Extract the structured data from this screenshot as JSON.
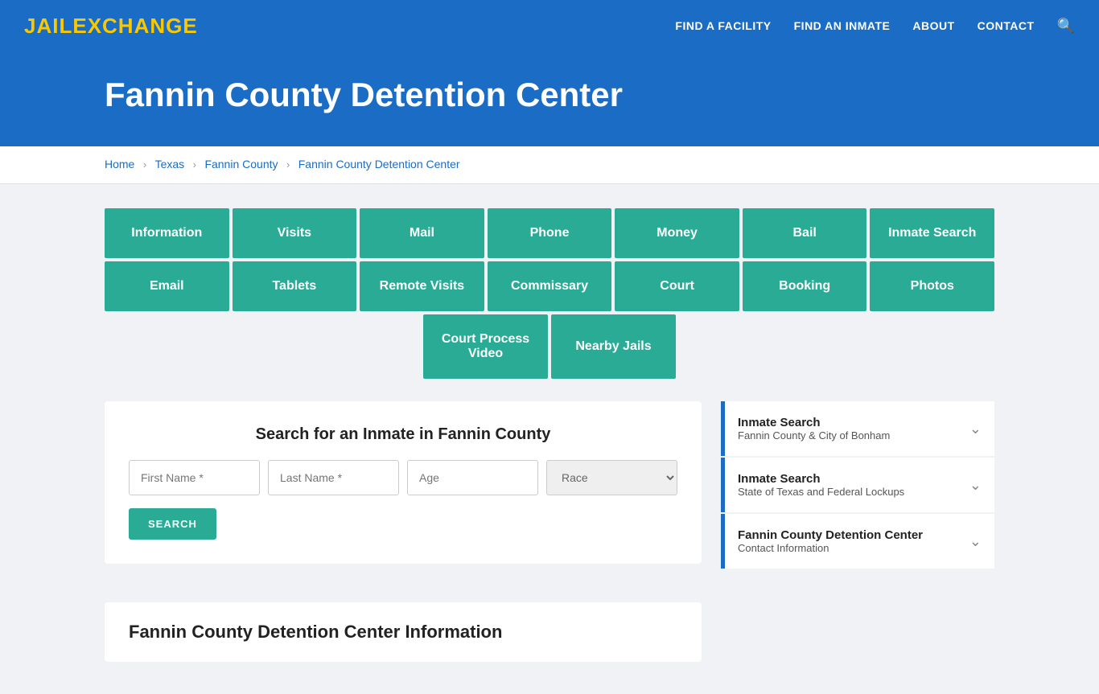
{
  "nav": {
    "logo_jail": "JAIL",
    "logo_exchange": "EXCHANGE",
    "links": [
      {
        "label": "FIND A FACILITY",
        "name": "find-facility"
      },
      {
        "label": "FIND AN INMATE",
        "name": "find-inmate"
      },
      {
        "label": "ABOUT",
        "name": "about"
      },
      {
        "label": "CONTACT",
        "name": "contact"
      }
    ]
  },
  "hero": {
    "title": "Fannin County Detention Center"
  },
  "breadcrumb": {
    "items": [
      {
        "label": "Home",
        "name": "breadcrumb-home"
      },
      {
        "label": "Texas",
        "name": "breadcrumb-texas"
      },
      {
        "label": "Fannin County",
        "name": "breadcrumb-county"
      },
      {
        "label": "Fannin County Detention Center",
        "name": "breadcrumb-facility"
      }
    ]
  },
  "grid_buttons": {
    "row1": [
      {
        "label": "Information",
        "name": "btn-information"
      },
      {
        "label": "Visits",
        "name": "btn-visits"
      },
      {
        "label": "Mail",
        "name": "btn-mail"
      },
      {
        "label": "Phone",
        "name": "btn-phone"
      },
      {
        "label": "Money",
        "name": "btn-money"
      },
      {
        "label": "Bail",
        "name": "btn-bail"
      },
      {
        "label": "Inmate Search",
        "name": "btn-inmate-search"
      }
    ],
    "row2": [
      {
        "label": "Email",
        "name": "btn-email"
      },
      {
        "label": "Tablets",
        "name": "btn-tablets"
      },
      {
        "label": "Remote Visits",
        "name": "btn-remote-visits"
      },
      {
        "label": "Commissary",
        "name": "btn-commissary"
      },
      {
        "label": "Court",
        "name": "btn-court"
      },
      {
        "label": "Booking",
        "name": "btn-booking"
      },
      {
        "label": "Photos",
        "name": "btn-photos"
      }
    ],
    "row3": [
      {
        "label": "Court Process Video",
        "name": "btn-court-process"
      },
      {
        "label": "Nearby Jails",
        "name": "btn-nearby-jails"
      }
    ]
  },
  "search": {
    "title": "Search for an Inmate in Fannin County",
    "first_name_placeholder": "First Name *",
    "last_name_placeholder": "Last Name *",
    "age_placeholder": "Age",
    "race_placeholder": "Race",
    "button_label": "SEARCH"
  },
  "sidebar": {
    "items": [
      {
        "title": "Inmate Search",
        "subtitle": "Fannin County & City of Bonham",
        "name": "sidebar-inmate-search-county"
      },
      {
        "title": "Inmate Search",
        "subtitle": "State of Texas and Federal Lockups",
        "name": "sidebar-inmate-search-state"
      },
      {
        "title": "Fannin County Detention Center",
        "subtitle": "Contact Information",
        "name": "sidebar-contact-info"
      }
    ]
  },
  "info_section": {
    "title": "Fannin County Detention Center Information"
  }
}
